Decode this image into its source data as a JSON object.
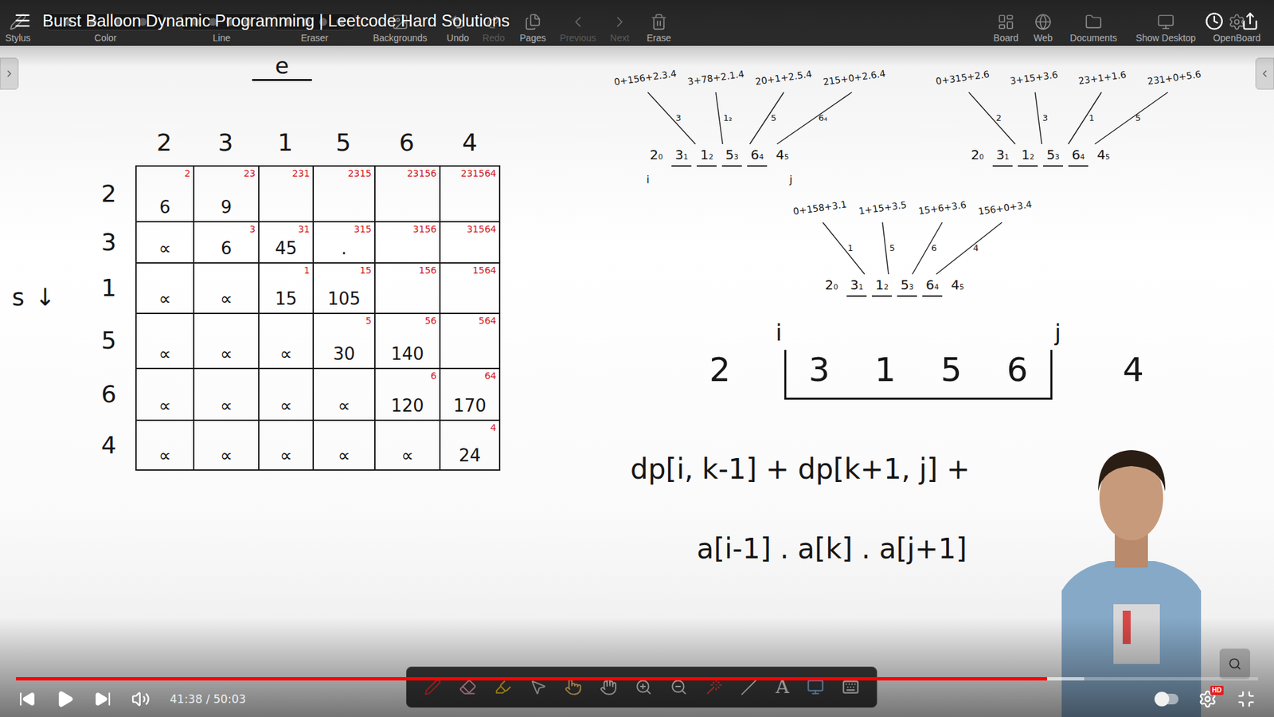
{
  "player": {
    "title": "Burst Balloon Dynamic Programming | Leetcode Hard Solutions",
    "time": "41:38 / 50:03",
    "progress": 0.83,
    "buffered": 0.86,
    "paused": true,
    "quality_badge": "HD"
  },
  "openboard": {
    "toolbar_left": [
      {
        "label": "Stylus",
        "kind": "tool",
        "disabled": false
      },
      {
        "label": "Color",
        "kind": "palette",
        "disabled": false
      },
      {
        "label": "Line",
        "kind": "palette",
        "disabled": false
      },
      {
        "label": "Eraser",
        "kind": "palette",
        "disabled": false
      },
      {
        "label": "Backgrounds",
        "kind": "tool",
        "disabled": false
      },
      {
        "label": "Undo",
        "kind": "tool",
        "disabled": false
      },
      {
        "label": "Redo",
        "kind": "tool",
        "disabled": true
      },
      {
        "label": "Pages",
        "kind": "tool",
        "disabled": false
      },
      {
        "label": "Previous",
        "kind": "tool",
        "disabled": true
      },
      {
        "label": "Next",
        "kind": "tool",
        "disabled": true
      },
      {
        "label": "Erase",
        "kind": "tool",
        "disabled": false
      }
    ],
    "toolbar_right": [
      {
        "label": "Board",
        "kind": "tool",
        "disabled": false
      },
      {
        "label": "Web",
        "kind": "tool",
        "disabled": false
      },
      {
        "label": "Documents",
        "kind": "tool",
        "disabled": false
      },
      {
        "label": "Show Desktop",
        "kind": "tool",
        "disabled": false
      },
      {
        "label": "OpenBoard",
        "kind": "tool",
        "disabled": false
      }
    ],
    "palette_text_glyph": "A"
  },
  "board": {
    "heading": "e",
    "columns": [
      "2",
      "3",
      "1",
      "5",
      "6",
      "4"
    ],
    "rows": [
      {
        "label": "2",
        "cells": [
          {
            "tag": "2",
            "value": "6"
          },
          {
            "tag": "23",
            "value": "9"
          },
          {
            "tag": "231",
            "value": ""
          },
          {
            "tag": "2315",
            "value": ""
          },
          {
            "tag": "23156",
            "value": ""
          },
          {
            "tag": "231564",
            "value": ""
          }
        ]
      },
      {
        "label": "3",
        "cells": [
          {
            "tag": "",
            "value": "∝"
          },
          {
            "tag": "3",
            "value": "6"
          },
          {
            "tag": "31",
            "value": "45"
          },
          {
            "tag": "315",
            "value": "."
          },
          {
            "tag": "3156",
            "value": ""
          },
          {
            "tag": "31564",
            "value": ""
          }
        ]
      },
      {
        "label": "1",
        "cells": [
          {
            "tag": "",
            "value": "∝"
          },
          {
            "tag": "",
            "value": "∝"
          },
          {
            "tag": "1",
            "value": "15"
          },
          {
            "tag": "15",
            "value": "105"
          },
          {
            "tag": "156",
            "value": ""
          },
          {
            "tag": "1564",
            "value": ""
          }
        ]
      },
      {
        "label": "5",
        "cells": [
          {
            "tag": "",
            "value": "∝"
          },
          {
            "tag": "",
            "value": "∝"
          },
          {
            "tag": "",
            "value": "∝"
          },
          {
            "tag": "5",
            "value": "30"
          },
          {
            "tag": "56",
            "value": "140"
          },
          {
            "tag": "564",
            "value": ""
          }
        ]
      },
      {
        "label": "6",
        "cells": [
          {
            "tag": "",
            "value": "∝"
          },
          {
            "tag": "",
            "value": "∝"
          },
          {
            "tag": "",
            "value": "∝"
          },
          {
            "tag": "",
            "value": "∝"
          },
          {
            "tag": "6",
            "value": "120"
          },
          {
            "tag": "64",
            "value": "170"
          }
        ]
      },
      {
        "label": "4",
        "cells": [
          {
            "tag": "",
            "value": "∝"
          },
          {
            "tag": "",
            "value": "∝"
          },
          {
            "tag": "",
            "value": "∝"
          },
          {
            "tag": "",
            "value": "∝"
          },
          {
            "tag": "",
            "value": "∝"
          },
          {
            "tag": "4",
            "value": "24"
          }
        ]
      }
    ],
    "direction": {
      "label": "s",
      "arrow": "↓"
    },
    "diagrams": [
      {
        "terms": [
          "0+156+2.3.4",
          "3+78+2.1.4",
          "20+1+2.5.4",
          "215+0+2.6.4"
        ],
        "branches": [
          "3",
          "1₂",
          "5",
          "6₄"
        ],
        "numbers": [
          "2",
          "3",
          "1",
          "5",
          "6",
          "4"
        ],
        "indices": [
          "0",
          "1",
          "2",
          "3",
          "4",
          "5"
        ],
        "ends": [
          "i",
          "j"
        ]
      },
      {
        "terms": [
          "0+315+2.6",
          "3+15+3.6",
          "23+1+1.6",
          "231+0+5.6"
        ],
        "branches": [
          "2",
          "3",
          "1",
          "5"
        ],
        "numbers": [
          "2",
          "3",
          "1",
          "5",
          "6",
          "4"
        ],
        "indices": [
          "0",
          "1",
          "2",
          "3",
          "4",
          "5"
        ],
        "ends": []
      },
      {
        "terms": [
          "0+158+3.1",
          "1+15+3.5",
          "15+6+3.6",
          "156+0+3.4"
        ],
        "branches": [
          "1",
          "5",
          "6",
          "4"
        ],
        "numbers": [
          "2",
          "3",
          "1",
          "5",
          "6",
          "4"
        ],
        "indices": [
          "0",
          "1",
          "2",
          "3",
          "4",
          "5"
        ],
        "ends": []
      }
    ],
    "sequence": {
      "numbers": [
        "2",
        "3",
        "1",
        "5",
        "6",
        "4"
      ],
      "start": "i",
      "end": "j"
    },
    "formula": [
      "dp[i, k-1] + dp[k+1, j] +",
      "a[i-1] . a[k] . a[j+1]"
    ]
  }
}
